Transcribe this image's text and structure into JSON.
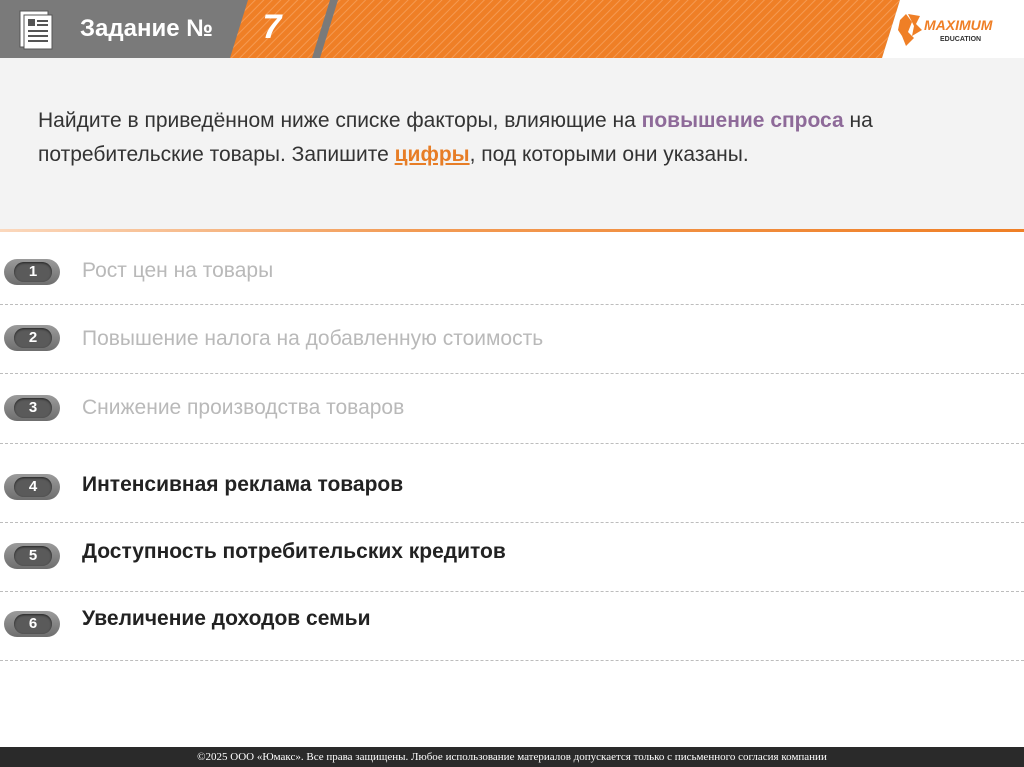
{
  "header": {
    "title": "Задание №",
    "number": "7",
    "logo_text": "MAXIMUM",
    "logo_sub": "EDUCATION",
    "accent_color": "#ef7f26"
  },
  "question": {
    "part1": "Найдите в приведённом ниже списке факторы, влияющие на ",
    "highlight1": "повышение спроса",
    "part2": " на потребительские товары. Запишите ",
    "highlight2": "цифры",
    "part3": ", под которыми они указаны."
  },
  "items": [
    {
      "num": "1",
      "text": "Рост цен на товары"
    },
    {
      "num": "2",
      "text": "Повышение налога на добавленную стоимость"
    },
    {
      "num": "3",
      "text": "Снижение производства товаров"
    },
    {
      "num": "4",
      "text": "Интенсивная реклама товаров"
    },
    {
      "num": "5",
      "text": "Доступность потребительских кредитов"
    },
    {
      "num": "6",
      "text": "Увеличение доходов семьи"
    }
  ],
  "footer": "©2025 ООО «Юмакс». Все права защищены. Любое использование материалов допускается только с  письменного согласия компании"
}
